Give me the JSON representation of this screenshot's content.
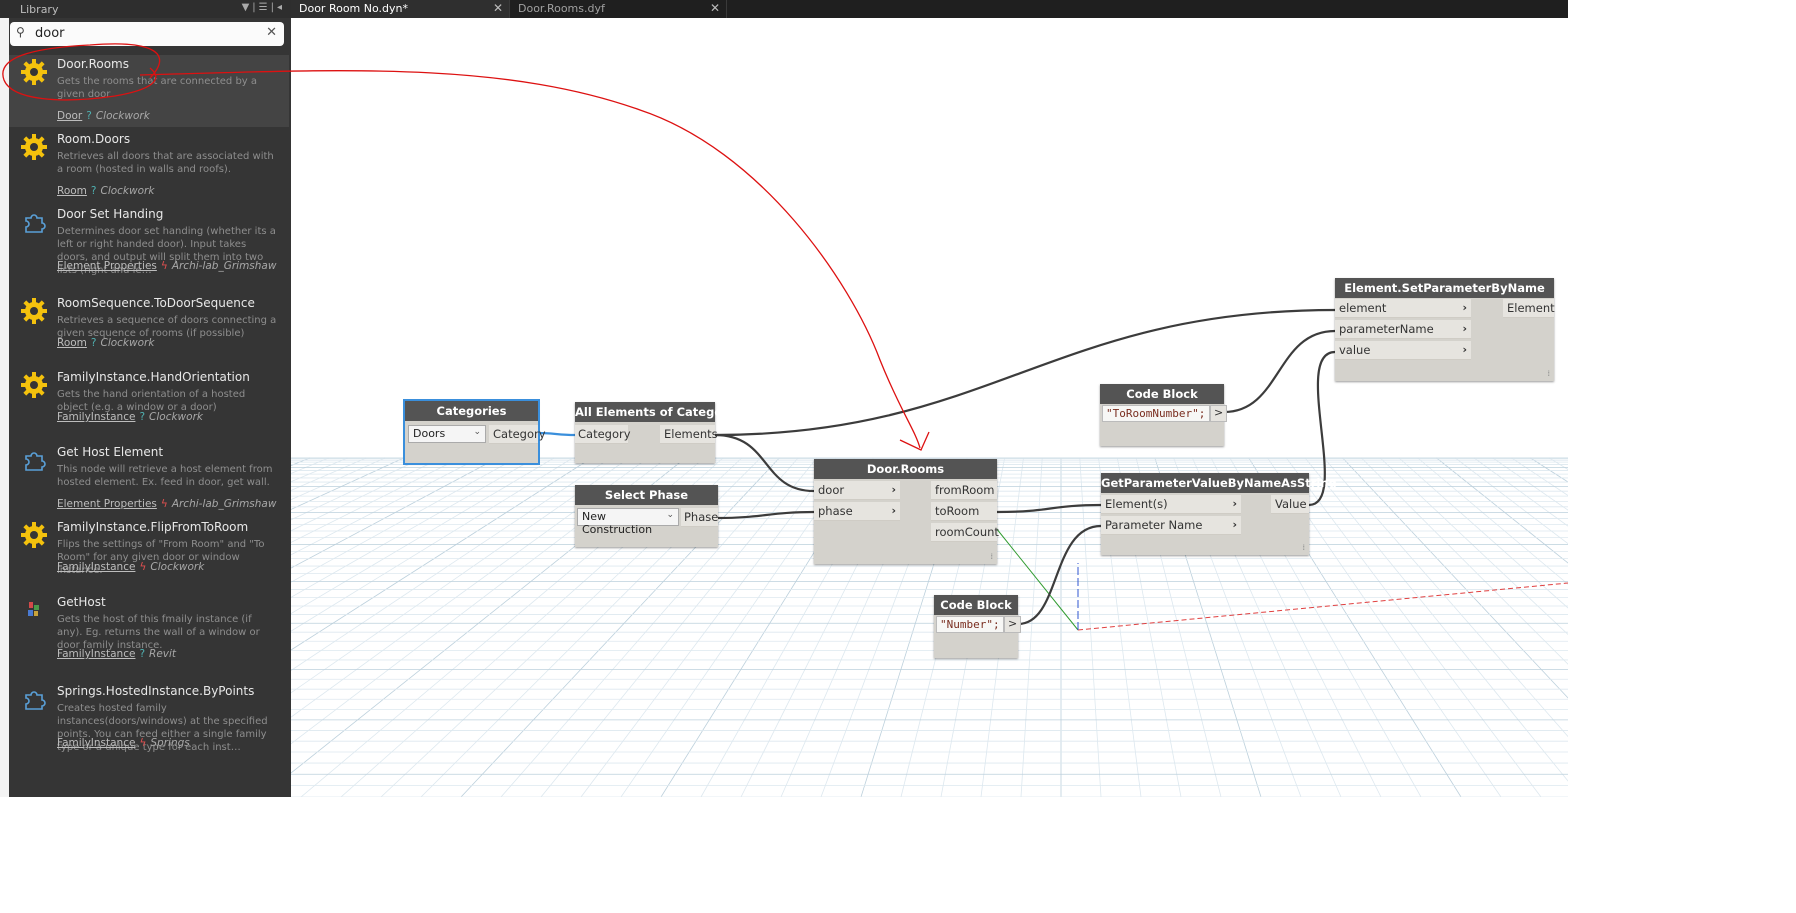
{
  "library": {
    "title": "Library",
    "search": {
      "value": "door",
      "placeholder": ""
    },
    "results": [
      {
        "name": "Door.Rooms",
        "desc": "Gets the rooms that are connected by a given door",
        "category": "Door",
        "marker": "?",
        "package": "Clockwork",
        "icon": "gear-icon"
      },
      {
        "name": "Room.Doors",
        "desc": "Retrieves all doors that are associated with a room (hosted in walls and roofs).",
        "category": "Room",
        "marker": "?",
        "package": "Clockwork",
        "icon": "gear-icon"
      },
      {
        "name": "Door Set Handing",
        "desc": "Determines door set handing (whether its a left or right handed door). Input takes doors, and output will split them into two lists (right and le…",
        "category": "Element Properties",
        "marker": "ϟ",
        "package": "Archi-lab_Grimshaw",
        "icon": "puzzle-icon"
      },
      {
        "name": "RoomSequence.ToDoorSequence",
        "desc": "Retrieves a sequence of doors connecting a given sequence of rooms (if possible)",
        "category": "Room",
        "marker": "?",
        "package": "Clockwork",
        "icon": "gear-icon"
      },
      {
        "name": "FamilyInstance.HandOrientation",
        "desc": "Gets the hand orientation of a hosted object (e.g. a window or a door)",
        "category": "FamilyInstance",
        "marker": "?",
        "package": "Clockwork",
        "icon": "gear-icon"
      },
      {
        "name": "Get Host Element",
        "desc": "This node will retrieve a host element from hosted element. Ex. feed in door, get wall.",
        "category": "Element Properties",
        "marker": "ϟ",
        "package": "Archi-lab_Grimshaw",
        "icon": "puzzle-icon"
      },
      {
        "name": "FamilyInstance.FlipFromToRoom",
        "desc": "Flips the settings of \"From Room\" and \"To Room\" for any given door or window instance.",
        "category": "FamilyInstance",
        "marker": "ϟ",
        "package": "Clockwork",
        "icon": "gear-icon"
      },
      {
        "name": "GetHost",
        "desc": "Gets the host of this fmaily instance (if any). Eg. returns the wall of a window or door family instance.",
        "category": "FamilyInstance",
        "marker": "?",
        "package": "Revit",
        "icon": "family-icon"
      },
      {
        "name": "Springs.HostedInstance.ByPoints",
        "desc": "Creates hosted family instances(doors/windows) at the specified points. You can feed either a single family type or a unique type for each inst…",
        "category": "FamilyInstance",
        "marker": "ϟ",
        "package": "Springs",
        "icon": "puzzle-icon"
      }
    ]
  },
  "tabs": [
    {
      "label": "Door Room No.dyn*",
      "active": true
    },
    {
      "label": "Door.Rooms.dyf",
      "active": false
    }
  ],
  "nodes": {
    "categories": {
      "title": "Categories",
      "dropdown": "Doors",
      "output": "Category"
    },
    "all_elements": {
      "title": "All Elements of Category",
      "input": "Category",
      "output": "Elements"
    },
    "select_phase": {
      "title": "Select Phase",
      "dropdown": "New Construction",
      "output": "Phase"
    },
    "door_rooms": {
      "title": "Door.Rooms",
      "inputs": [
        "door",
        "phase"
      ],
      "outputs": [
        "fromRoom",
        "toRoom",
        "roomCount"
      ]
    },
    "code_block_1": {
      "title": "Code Block",
      "code": "\"ToRoomNumber\";",
      "output": ">"
    },
    "code_block_2": {
      "title": "Code Block",
      "code": "\"Number\";",
      "output": ">"
    },
    "get_param": {
      "title": "GetParameterValueByNameAsString",
      "inputs": [
        "Element(s)",
        "Parameter Name"
      ],
      "output": "Value"
    },
    "set_param": {
      "title": "Element.SetParameterByName",
      "inputs": [
        "element",
        "parameterName",
        "value"
      ],
      "output": "Element"
    }
  },
  "colors": {
    "annotation": "#dd1111",
    "wire": "#3c3c3c",
    "selected_wire": "#3a8fdc",
    "node_header": "#545454",
    "library_bg": "#353535"
  }
}
